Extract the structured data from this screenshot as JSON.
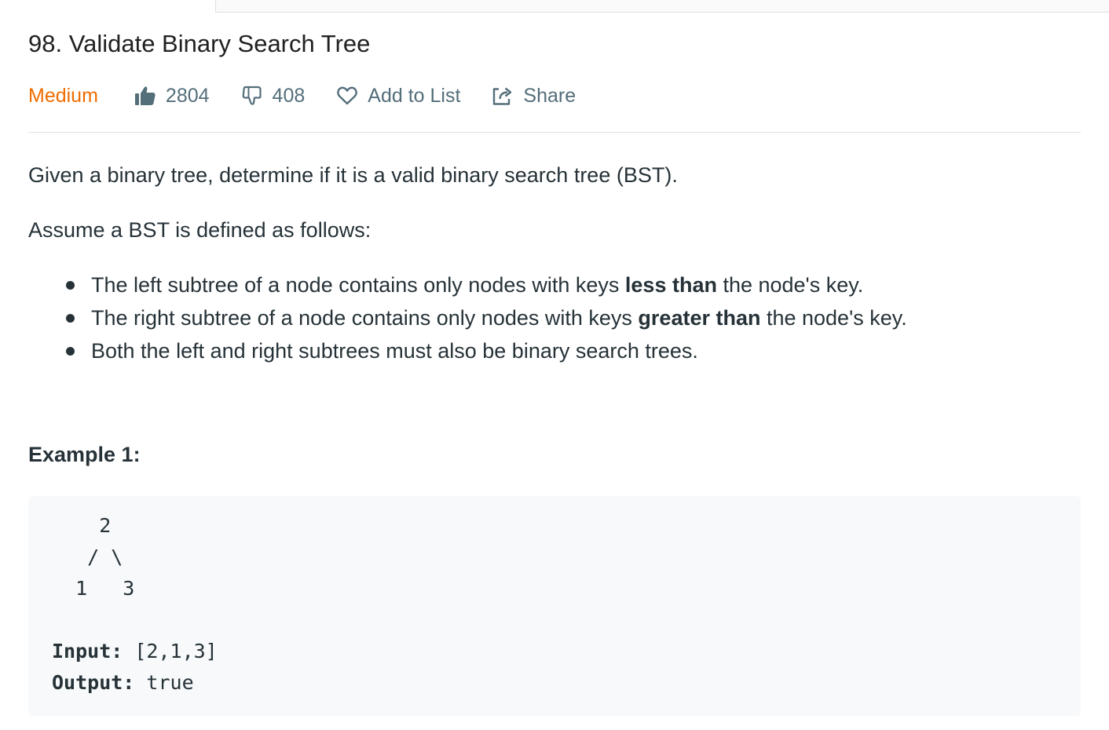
{
  "problem": {
    "title": "98. Validate Binary Search Tree",
    "difficulty": "Medium",
    "likes": "2804",
    "dislikes": "408",
    "add_to_list_label": "Add to List",
    "share_label": "Share"
  },
  "description": {
    "intro": "Given a binary tree, determine if it is a valid binary search tree (BST).",
    "assume": "Assume a BST is defined as follows:",
    "rules": [
      {
        "pre": "The left subtree of a node contains only nodes with keys ",
        "bold": "less than",
        "post": " the node's key."
      },
      {
        "pre": "The right subtree of a node contains only nodes with keys ",
        "bold": "greater than",
        "post": " the node's key."
      },
      {
        "text": "Both the left and right subtrees must also be binary search trees."
      }
    ]
  },
  "example1": {
    "title": "Example 1:",
    "tree_lines": [
      "    2",
      "   / \\",
      "  1   3"
    ],
    "input_label": "Input:",
    "input_value": " [2,1,3]",
    "output_label": "Output:",
    "output_value": " true"
  },
  "colors": {
    "difficulty_medium": "#ef6c00",
    "text": "#263238",
    "muted": "#546e7a",
    "code_bg": "#f7f9fa"
  },
  "icons": [
    "thumbs-up-icon",
    "thumbs-down-icon",
    "heart-icon",
    "share-icon"
  ]
}
